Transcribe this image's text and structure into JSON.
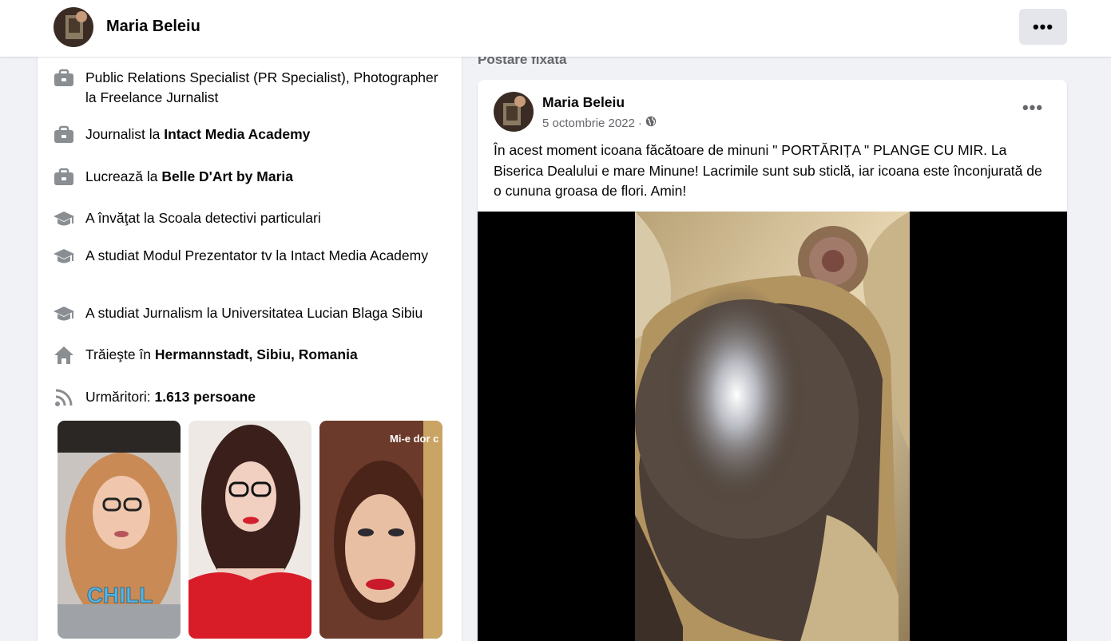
{
  "profile": {
    "name": "Maria Beleiu",
    "more_label": "•••"
  },
  "intro": {
    "items": [
      {
        "icon": "briefcase-icon",
        "text": "Public Relations Specialist (PR Specialist), Photographer la Freelance Jurnalist",
        "bold": ""
      },
      {
        "icon": "briefcase-icon",
        "text": "Journalist la ",
        "bold": "Intact Media Academy"
      },
      {
        "icon": "briefcase-icon",
        "text": "Lucrează la ",
        "bold": "Belle D'Art by Maria"
      },
      {
        "icon": "graduation-cap-icon",
        "text": "A învăţat la Scoala detectivi particulari",
        "bold": ""
      },
      {
        "icon": "graduation-cap-icon",
        "text": "A studiat Modul Prezentator tv la Intact Media Academy",
        "bold": ""
      },
      {
        "icon": "graduation-cap-icon",
        "text": "A studiat Jurnalism la Universitatea Lucian Blaga Sibiu",
        "bold": ""
      },
      {
        "icon": "home-icon",
        "text": "Trăieşte în ",
        "bold": "Hermannstadt, Sibiu, Romania"
      },
      {
        "icon": "rss-icon",
        "text": "Urmăritori: ",
        "bold": "1.613 persoane"
      }
    ],
    "photos": [
      {
        "caption": "CHILL"
      },
      {
        "caption": ""
      },
      {
        "caption": "Mi-e dor c buni, si dre"
      }
    ]
  },
  "pinned": {
    "label": "Postare fixată",
    "author": "Maria Beleiu",
    "date": "5 octombrie 2022",
    "separator": "·",
    "audience_icon": "globe-icon",
    "more_label": "•••",
    "text": "În acest moment icoana făcătoare de minuni \" PORTĂRIȚA \" PLANGE CU MIR. La Biserica Dealului e mare Minune! Lacrimile sunt sub sticlă, iar icoana este înconjurată de o cununa groasa de flori. Amin!"
  },
  "colors": {
    "background": "#f0f2f5",
    "card": "#ffffff",
    "secondary_text": "#65676b",
    "icon_gray": "#8a8d91",
    "button_gray": "#e4e6eb"
  }
}
